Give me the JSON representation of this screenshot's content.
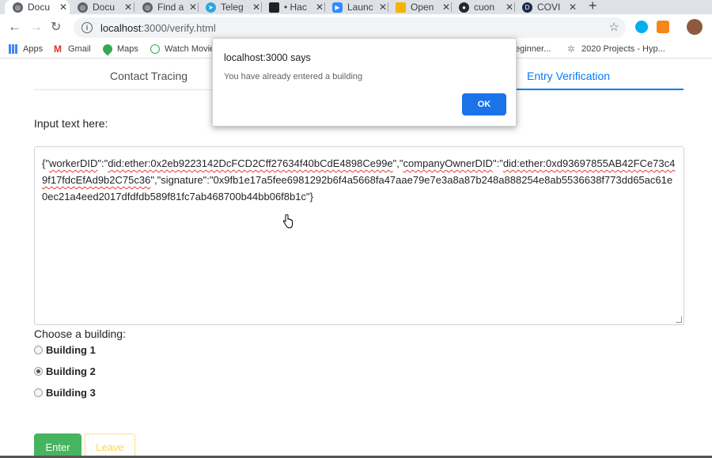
{
  "browser": {
    "tabs": [
      {
        "label": "Docu",
        "icon": "globe-icon",
        "active": true
      },
      {
        "label": "Docu",
        "icon": "globe-icon"
      },
      {
        "label": "Find a",
        "icon": "globe-icon"
      },
      {
        "label": "Teleg",
        "icon": "telegram-icon"
      },
      {
        "label": "• Hac",
        "icon": "document-icon"
      },
      {
        "label": "Launc",
        "icon": "zoom-icon"
      },
      {
        "label": "Open",
        "icon": "slides-icon"
      },
      {
        "label": "cuon",
        "icon": "github-icon"
      },
      {
        "label": "COVI",
        "icon": "d-icon"
      }
    ],
    "url_host": "localhost",
    "url_path": ":3000/verify.html"
  },
  "bookmarks": [
    {
      "label": "Apps",
      "icon": "apps-grid-icon"
    },
    {
      "label": "Gmail",
      "icon": "gmail-icon"
    },
    {
      "label": "Maps",
      "icon": "maps-icon"
    },
    {
      "label": "Watch Movie",
      "icon": "play-icon"
    },
    {
      "label": "eginner...",
      "icon": ""
    },
    {
      "label": "2020 Projects - Hyp...",
      "icon": "gear-icon"
    }
  ],
  "page": {
    "nav": {
      "contact_tracing": "Contact Tracing",
      "entry_verification": "Entry Verification"
    },
    "input_label": "Input text here:",
    "textarea_value": "{\"workerDID\":\"did:ether:0x2eb9223142DcFCD2Cff27634f40bCdE4898Ce99e\",\"companyOwnerDID\":\"did:ether:0xd93697855AB42FCe73c49f17fdcEfAd9b2C75c36\",\"signature\":\"0x9fb1e17a5fee6981292b6f4a5668fa47aae79e7e3a8a87b248a888254e8ab5536638f773dd65ac61e0ec21a4eed2017dfdfdb589f81fc7ab468700b44bb06f8b1c\"}",
    "choose_label": "Choose a building:",
    "buildings": [
      {
        "label": "Building 1",
        "checked": false
      },
      {
        "label": "Building 2",
        "checked": true
      },
      {
        "label": "Building 3",
        "checked": false
      }
    ],
    "enter_button": "Enter",
    "leave_button": "Leave"
  },
  "alert": {
    "title": "localhost:3000 says",
    "message": "You have already entered a building",
    "ok_label": "OK"
  },
  "colors": {
    "primary": "#007bff",
    "success": "#28a745",
    "warning": "#ffc107",
    "dialog_button": "#1a73e8"
  }
}
